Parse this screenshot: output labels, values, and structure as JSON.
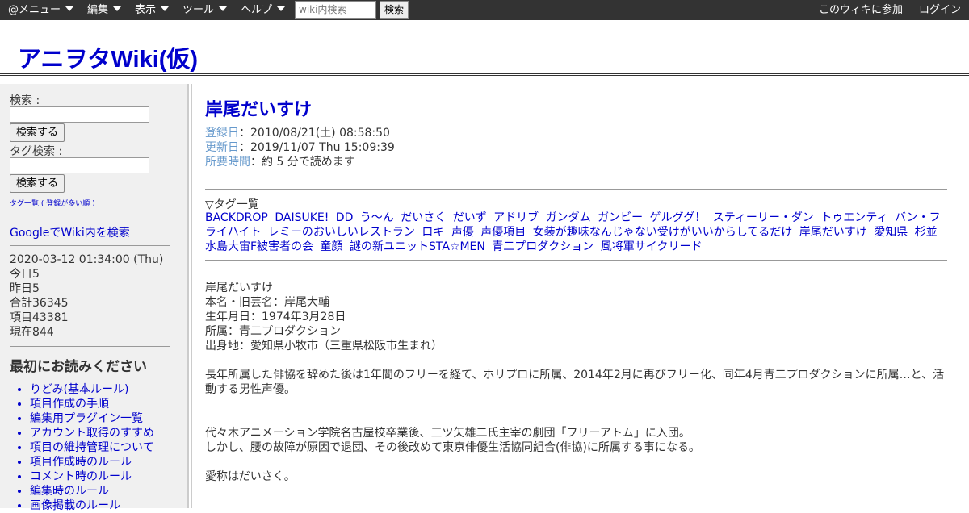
{
  "topbar": {
    "menus": [
      {
        "label": "@メニュー"
      },
      {
        "label": "編集"
      },
      {
        "label": "表示"
      },
      {
        "label": "ツール"
      },
      {
        "label": "ヘルプ"
      }
    ],
    "search_placeholder": "wiki内検索",
    "search_button": "検索",
    "join_label": "このウィキに参加",
    "login_label": "ログイン"
  },
  "site": {
    "title": "アニヲタWiki(仮)"
  },
  "sidebar": {
    "search_label": "検索 :",
    "search_button": "検索する",
    "tag_search_label": "タグ検索 :",
    "tag_search_button": "検索する",
    "tag_list_link": "タグ一覧 ( 登録が多い順 )",
    "google_link": "GoogleでWiki内を検索",
    "stats": {
      "datetime": "2020-03-12 01:34:00 (Thu)",
      "today": "今日5",
      "yesterday": "昨日5",
      "total": "合計36345",
      "items": "項目43381",
      "current": "現在844"
    },
    "read_first_heading": "最初にお読みください",
    "read_first_items": [
      "りどみ(基本ルール)",
      "項目作成の手順",
      "編集用プラグイン一覧",
      "アカウント取得のすすめ",
      "項目の維持管理について",
      "項目作成時のルール",
      "コメント時のルール",
      "編集時のルール",
      "画像掲載のルール"
    ]
  },
  "article": {
    "title": "岸尾だいすけ",
    "registered_label": "登録日",
    "registered_value": "：2010/08/21(土) 08:58:50",
    "updated_label": "更新日",
    "updated_value": "：2019/11/07 Thu 15:09:39",
    "read_time_label": "所要時間",
    "read_time_value": "：約 5 分で読めます",
    "tags_heading": "▽タグ一覧",
    "tags": [
      "BACKDROP",
      "DAISUKE!",
      "DD",
      "う〜ん",
      "だいさく",
      "だいず",
      "アドリブ",
      "ガンダム",
      "ガンビー",
      "ゲルググ！",
      "スティーリー・ダン",
      "トゥエンティ",
      "バン・フライハイト",
      "レミーのおいしいレストラン",
      "ロキ",
      "声優",
      "声優項目",
      "女装が趣味なんじゃない受けがいいからしてるだけ",
      "岸尾だいすけ",
      "愛知県",
      "杉並",
      "水島大宙F被害者の会",
      "童顔",
      "謎の新ユニットSTA☆MEN",
      "青二プロダクション",
      "風将軍サイクリード"
    ],
    "body": {
      "name": "岸尾だいすけ",
      "real_name": "本名・旧芸名：岸尾大輔",
      "birthday": "生年月日：1974年3月28日",
      "agency": "所属：青二プロダクション",
      "birthplace": "出身地：愛知県小牧市（三重県松阪市生まれ）",
      "para1": "長年所属した俳協を辞めた後は1年間のフリーを経て、ホリプロに所属、2014年2月に再びフリー化、同年4月青二プロダクションに所属…と、活動する男性声優。",
      "para2a": "代々木アニメーション学院名古屋校卒業後、三ツ矢雄二氏主宰の劇団「フリーアトム」に入団。",
      "para2b": "しかし、腰の故障が原因で退団、その後改めて東京俳優生活協同組合(俳協)に所属する事になる。",
      "para3": "愛称はだいさく。"
    }
  }
}
